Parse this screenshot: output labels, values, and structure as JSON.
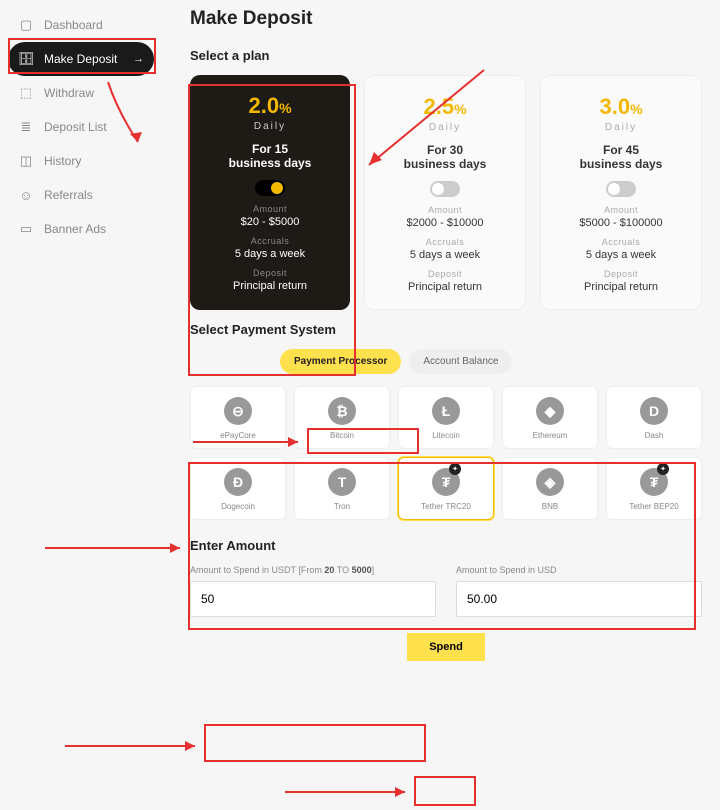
{
  "sidebar": {
    "items": [
      {
        "label": "Dashboard",
        "icon": "▢"
      },
      {
        "label": "Make Deposit",
        "icon": "🗄",
        "active": true
      },
      {
        "label": "Withdraw",
        "icon": "⬚"
      },
      {
        "label": "Deposit List",
        "icon": "≣"
      },
      {
        "label": "History",
        "icon": "◫"
      },
      {
        "label": "Referrals",
        "icon": "☺"
      },
      {
        "label": "Banner Ads",
        "icon": "▭"
      }
    ]
  },
  "page_title": "Make Deposit",
  "section_plan": "Select a plan",
  "plans": [
    {
      "pct": "2.0",
      "pctsign": "%",
      "daily": "Daily",
      "for1": "For 15",
      "for2": "business days",
      "amount_lbl": "Amount",
      "amount": "$20 - $5000",
      "accruals_lbl": "Accruals",
      "accruals": "5 days a week",
      "deposit_lbl": "Deposit",
      "deposit": "Principal return",
      "selected": true
    },
    {
      "pct": "2.5",
      "pctsign": "%",
      "daily": "Daily",
      "for1": "For 30",
      "for2": "business days",
      "amount_lbl": "Amount",
      "amount": "$2000 - $10000",
      "accruals_lbl": "Accruals",
      "accruals": "5 days a week",
      "deposit_lbl": "Deposit",
      "deposit": "Principal return"
    },
    {
      "pct": "3.0",
      "pctsign": "%",
      "daily": "Daily",
      "for1": "For 45",
      "for2": "business days",
      "amount_lbl": "Amount",
      "amount": "$5000 - $100000",
      "accruals_lbl": "Accruals",
      "accruals": "5 days a week",
      "deposit_lbl": "Deposit",
      "deposit": "Principal return"
    }
  ],
  "section_payment": "Select Payment System",
  "paytabs": [
    {
      "label": "Payment Processor",
      "active": true
    },
    {
      "label": "Account Balance"
    }
  ],
  "processors": [
    {
      "label": "ePayCore",
      "glyph": "⊖"
    },
    {
      "label": "Bitcoin",
      "glyph": "₿"
    },
    {
      "label": "Litecoin",
      "glyph": "Ł"
    },
    {
      "label": "Ethereum",
      "glyph": "◆"
    },
    {
      "label": "Dash",
      "glyph": "D"
    },
    {
      "label": "Dogecoin",
      "glyph": "Ð"
    },
    {
      "label": "Tron",
      "glyph": "T"
    },
    {
      "label": "Tether TRC20",
      "glyph": "₮",
      "selected": true,
      "badge": "✦"
    },
    {
      "label": "BNB",
      "glyph": "◈"
    },
    {
      "label": "Tether BEP20",
      "glyph": "₮",
      "badge": "✦"
    }
  ],
  "section_amount": "Enter Amount",
  "amount": {
    "left_label_pre": "Amount to Spend in USDT [From ",
    "left_min": "20",
    "left_mid": " TO ",
    "left_max": "5000",
    "left_post": "]",
    "left_value": "50",
    "right_label": "Amount to Spend in USD",
    "right_value": "50.00"
  },
  "spend_label": "Spend"
}
